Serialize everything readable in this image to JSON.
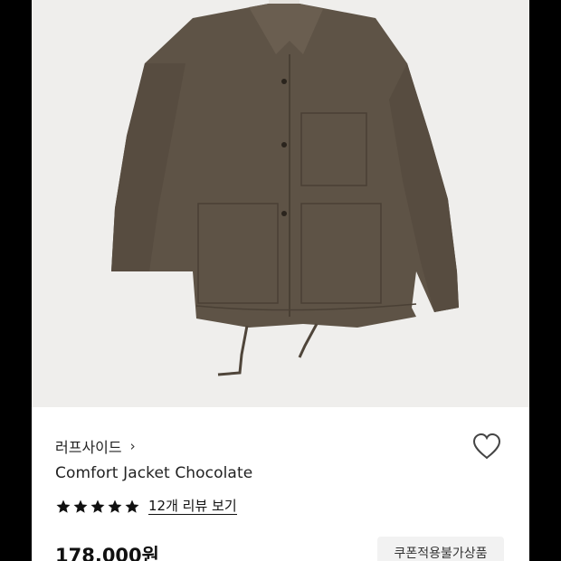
{
  "product": {
    "brand": "러프사이드",
    "brand_chevron": "›",
    "name": "Comfort Jacket Chocolate",
    "rating_stars": 5,
    "reviews_label": "12개 리뷰 보기",
    "price": "178,000원",
    "coupon_badge": "쿠폰적용불가상품",
    "image_alt": "brown jacket product photo"
  },
  "icons": {
    "wishlist": "heart-outline-icon",
    "star": "star-icon",
    "brand_link": "chevron-right-icon"
  },
  "colors": {
    "jacket": "#5e5346",
    "image_bg": "#efeeec",
    "star": "#111111",
    "badge_bg": "#f2f2f2"
  }
}
